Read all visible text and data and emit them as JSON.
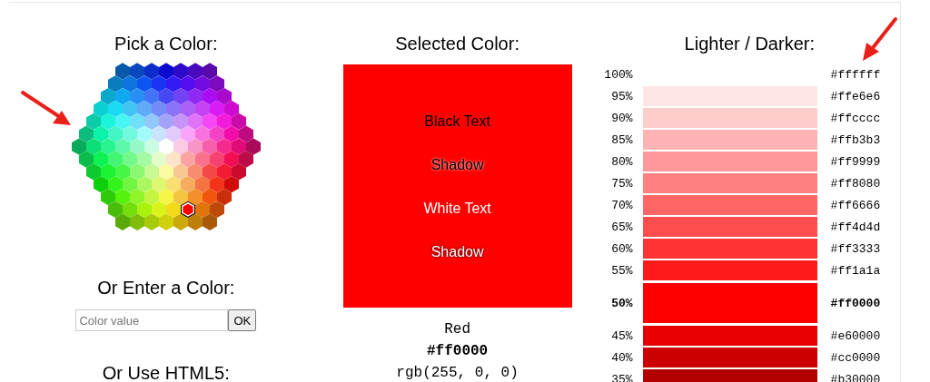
{
  "picker": {
    "heading": "Pick a Color:",
    "enter_heading": "Or Enter a Color:",
    "input": {
      "placeholder": "Color value"
    },
    "ok_button": "OK",
    "html5_heading": "Or Use HTML5:"
  },
  "selected_color": {
    "heading": "Selected Color:",
    "samples": [
      {
        "kind": "black",
        "text": "Black Text"
      },
      {
        "kind": "black-shadow",
        "text": "Shadow"
      },
      {
        "kind": "white",
        "text": "White Text"
      },
      {
        "kind": "white-shadow",
        "text": "Shadow"
      }
    ],
    "name": "Red",
    "hex": "#ff0000",
    "rgb": "rgb(255, 0, 0)"
  },
  "shades": {
    "heading": "Lighter / Darker:",
    "rows": [
      {
        "kind": "label-only",
        "percent": "100%",
        "hex": "#ffffff",
        "selected": false
      },
      {
        "kind": "bar",
        "percent": "95%",
        "hex": "#ffe6e6",
        "selected": false
      },
      {
        "kind": "bar",
        "percent": "90%",
        "hex": "#ffcccc",
        "selected": false
      },
      {
        "kind": "bar",
        "percent": "85%",
        "hex": "#ffb3b3",
        "selected": false
      },
      {
        "kind": "bar",
        "percent": "80%",
        "hex": "#ff9999",
        "selected": false
      },
      {
        "kind": "bar",
        "percent": "75%",
        "hex": "#ff8080",
        "selected": false
      },
      {
        "kind": "bar",
        "percent": "70%",
        "hex": "#ff6666",
        "selected": false
      },
      {
        "kind": "bar",
        "percent": "65%",
        "hex": "#ff4d4d",
        "selected": false
      },
      {
        "kind": "bar",
        "percent": "60%",
        "hex": "#ff3333",
        "selected": false
      },
      {
        "kind": "bar",
        "percent": "55%",
        "hex": "#ff1a1a",
        "selected": false
      },
      {
        "kind": "bar",
        "percent": "50%",
        "hex": "#ff0000",
        "selected": true
      },
      {
        "kind": "bar",
        "percent": "45%",
        "hex": "#e60000",
        "selected": false
      },
      {
        "kind": "bar",
        "percent": "40%",
        "hex": "#cc0000",
        "selected": false
      },
      {
        "kind": "bar",
        "percent": "35%",
        "hex": "#b30000",
        "selected": false
      }
    ]
  }
}
